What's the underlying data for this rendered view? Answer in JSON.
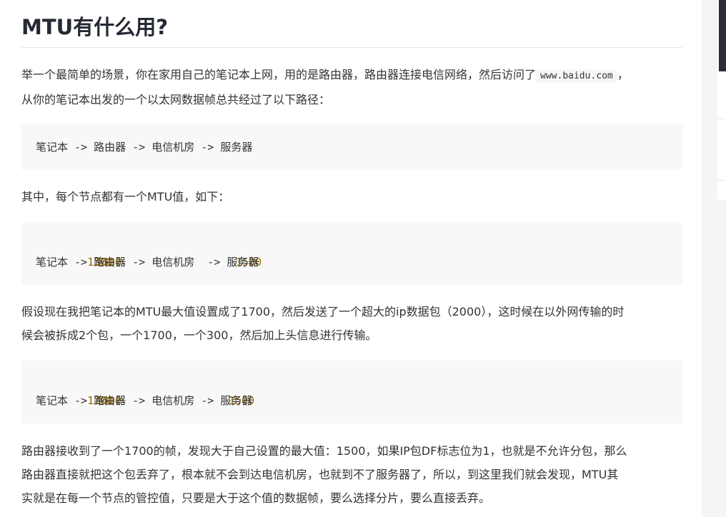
{
  "article": {
    "title": "MTU有什么用?",
    "para1_before": "举一个最简单的场景，你在家用自己的笔记本上网，用的是路由器，路由器连接电信网络，然后访问了",
    "para1_code": "www.baidu.com",
    "para1_after": "，",
    "para1_line2": "从你的笔记本出发的一个以太网数据帧总共经过了以下路径：",
    "code1": "笔记本 -> 路由器 -> 电信机房 -> 服务器",
    "para2": "其中，每个节点都有一个MTU值，如下：",
    "code2": {
      "n1": "1500",
      "n2": "1500",
      "n3": "1500",
      "path": "笔记本 -> 路由器 -> 电信机房  -> 服务器"
    },
    "para3_line1": "假设现在我把笔记本的MTU最大值设置成了1700，然后发送了一个超大的ip数据包（2000），这时候在以外网传输的时",
    "para3_line2": "候会被拆成2个包，一个1700，一个300，然后加上头信息进行传输。",
    "code3": {
      "n1": "1700",
      "n2": "1500",
      "n3": "1500",
      "path": "笔记本 -> 路由器 -> 电信机房 -> 服务器"
    },
    "para4_line1": "路由器接收到了一个1700的帧，发现大于自己设置的最大值：1500，如果IP包DF标志位为1，也就是不允许分包，那么",
    "para4_line2": "路由器直接就把这个包丢弃了，根本就不会到达电信机房，也就到不了服务器了，所以，到这里我们就会发现，MTU其",
    "para4_line3": "实就是在每一个节点的管控值，只要是大于这个值的数据帧，要么选择分片，要么直接丢弃。"
  },
  "colors": {
    "number": "#986801",
    "code_bg": "#f8f8f8",
    "text": "#333333"
  }
}
